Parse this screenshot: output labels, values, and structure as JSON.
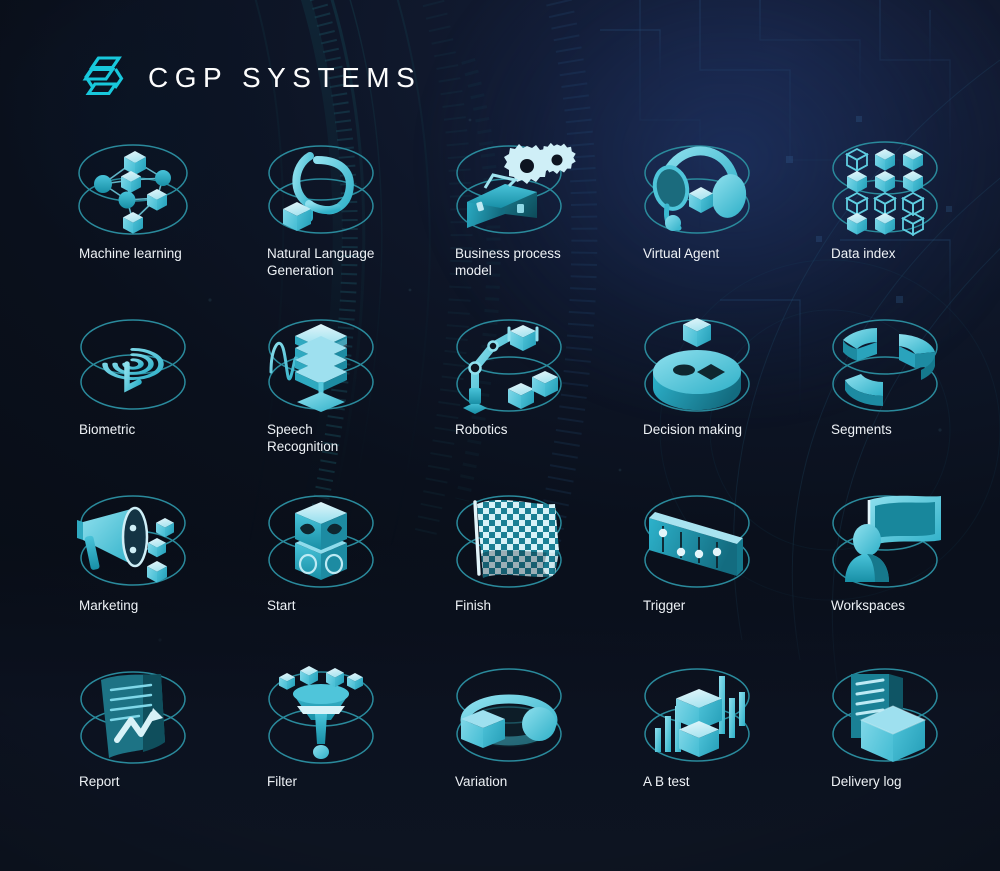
{
  "brand": {
    "name": "CGP SYSTEMS",
    "logo_icon": "hex-s-logo-icon",
    "accent_color": "#18c8dc",
    "text_color": "#fdfdfd"
  },
  "theme": {
    "background_color": "#0b1018",
    "panel_dark": "#0d1420",
    "icon_cyan": "#3fc6d9",
    "icon_cyan_light": "#9fe3ef",
    "icon_cyan_dark": "#17788c",
    "ellipse_stroke": "#2a8a9c",
    "label_color": "#eef2f6"
  },
  "grid": {
    "columns": 5,
    "rows": 4,
    "items": [
      {
        "label": "Machine learning",
        "icon": "machine-learning-icon"
      },
      {
        "label": "Natural Language\nGeneration",
        "icon": "natural-language-generation-icon"
      },
      {
        "label": "Business process\nmodel",
        "icon": "business-process-model-icon"
      },
      {
        "label": "Virtual Agent",
        "icon": "virtual-agent-icon"
      },
      {
        "label": "Data index",
        "icon": "data-index-icon"
      },
      {
        "label": "Biometric",
        "icon": "biometric-fingerprint-icon"
      },
      {
        "label": "Speech\nRecognition",
        "icon": "speech-recognition-icon"
      },
      {
        "label": "Robotics",
        "icon": "robotics-arm-icon"
      },
      {
        "label": "Decision making",
        "icon": "decision-making-icon"
      },
      {
        "label": "Segments",
        "icon": "segments-donut-icon"
      },
      {
        "label": "Marketing",
        "icon": "marketing-megaphone-icon"
      },
      {
        "label": "Start",
        "icon": "start-cubes-icon"
      },
      {
        "label": "Finish",
        "icon": "finish-flag-icon"
      },
      {
        "label": "Trigger",
        "icon": "trigger-sliders-icon"
      },
      {
        "label": "Workspaces",
        "icon": "workspaces-icon"
      },
      {
        "label": "Report",
        "icon": "report-document-icon"
      },
      {
        "label": "Filter",
        "icon": "filter-funnel-icon"
      },
      {
        "label": "Variation",
        "icon": "variation-icon"
      },
      {
        "label": "A B test",
        "icon": "ab-test-icon"
      },
      {
        "label": "Delivery log",
        "icon": "delivery-log-icon"
      }
    ]
  }
}
